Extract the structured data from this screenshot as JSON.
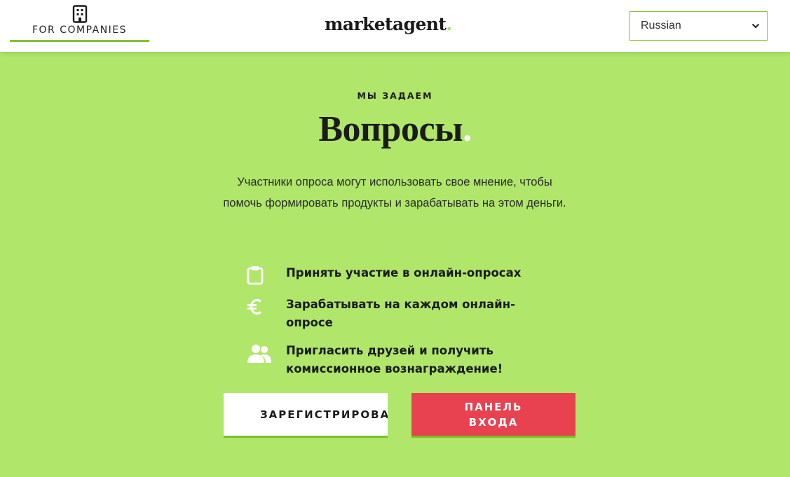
{
  "header": {
    "for_companies_label": "FOR COMPANIES",
    "logo_text": "marketagent",
    "logo_dot": ".",
    "language": {
      "selected": "Russian"
    }
  },
  "hero": {
    "eyebrow": "МЫ ЗАДАЕМ",
    "headline": "Вопросы",
    "headline_dot": ".",
    "description": "Участники опроса могут использовать свое мнение, чтобы помочь формировать продукты и зарабатывать на этом деньги."
  },
  "features": [
    {
      "icon": "clipboard-icon",
      "text": "Принять участие в онлайн-опросах"
    },
    {
      "icon": "euro-icon",
      "text": "Зарабатывать на каждом онлайн-опросе"
    },
    {
      "icon": "users-icon",
      "text": "Пригласить друзей и получить комиссионное вознаграждение!"
    }
  ],
  "buttons": {
    "register_label": "ЗАРЕГИСТРИРОВАТЬСЯ",
    "login_label": "ПАНЕЛЬ ВХОДА"
  },
  "colors": {
    "background": "#b0e66a",
    "accent_green": "#86c232",
    "login_red": "#e84150",
    "header_bg": "#ffffff"
  }
}
